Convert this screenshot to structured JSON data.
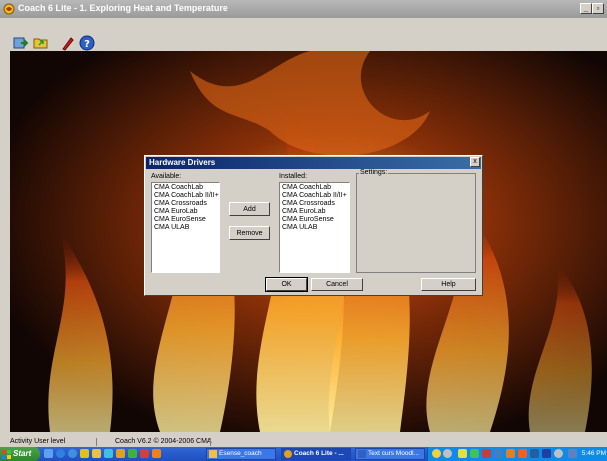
{
  "window": {
    "title": "Coach 6 Lite - 1. Exploring Heat and Temperature"
  },
  "dialog": {
    "title": "Hardware Drivers",
    "available_label": "Available:",
    "installed_label": "Installed:",
    "settings_label": "Settings:",
    "available_items": [
      "CMA CoachLab",
      "CMA CoachLab II/II+",
      "CMA Crossroads",
      "CMA EuroLab",
      "CMA EuroSense",
      "CMA ULAB"
    ],
    "installed_items": [
      "CMA CoachLab",
      "CMA CoachLab II/II+",
      "CMA Crossroads",
      "CMA EuroLab",
      "CMA EuroSense",
      "CMA ULAB"
    ],
    "add_label": "Add",
    "remove_label": "Remove",
    "ok_label": "OK",
    "cancel_label": "Cancel",
    "help_label": "Help",
    "close_glyph": "x"
  },
  "statusbar": {
    "level": "Activity User level",
    "version": "Coach V6.2 © 2004-2006 CMA"
  },
  "taskbar": {
    "start_label": "Start",
    "tasks": [
      "Esense_coach",
      "Coach 6 Lite - ...",
      "Text curs Moodl..."
    ],
    "clock": "5:46 PM"
  },
  "colors": {
    "titlebar": "#a0a0a0",
    "dialog_title": "#0a246a",
    "taskbar": "#245edb",
    "start": "#3c9a3c"
  }
}
